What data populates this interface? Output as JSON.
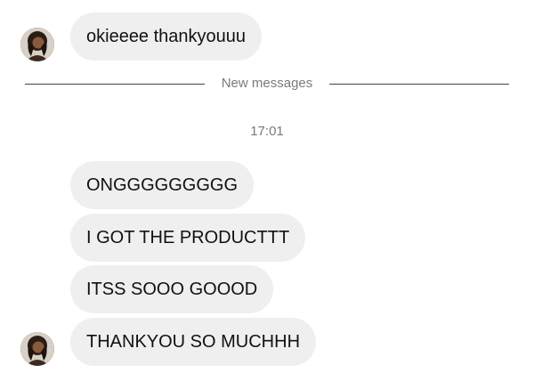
{
  "messages": [
    {
      "text": "okieeee thankyouuu"
    },
    {
      "text": "ONGGGGGGGGG"
    },
    {
      "text": "I GOT THE PRODUCTTT"
    },
    {
      "text": "ITSS SOOO GOOOD"
    },
    {
      "text": "THANKYOU SO MUCHHH"
    }
  ],
  "divider": {
    "label": "New messages"
  },
  "timestamp": "17:01",
  "colors": {
    "bubble": "#efefef",
    "text": "#111111",
    "meta_text": "#7a7a7a",
    "background": "#ffffff"
  },
  "icons": {
    "avatar": "avatar-icon"
  }
}
